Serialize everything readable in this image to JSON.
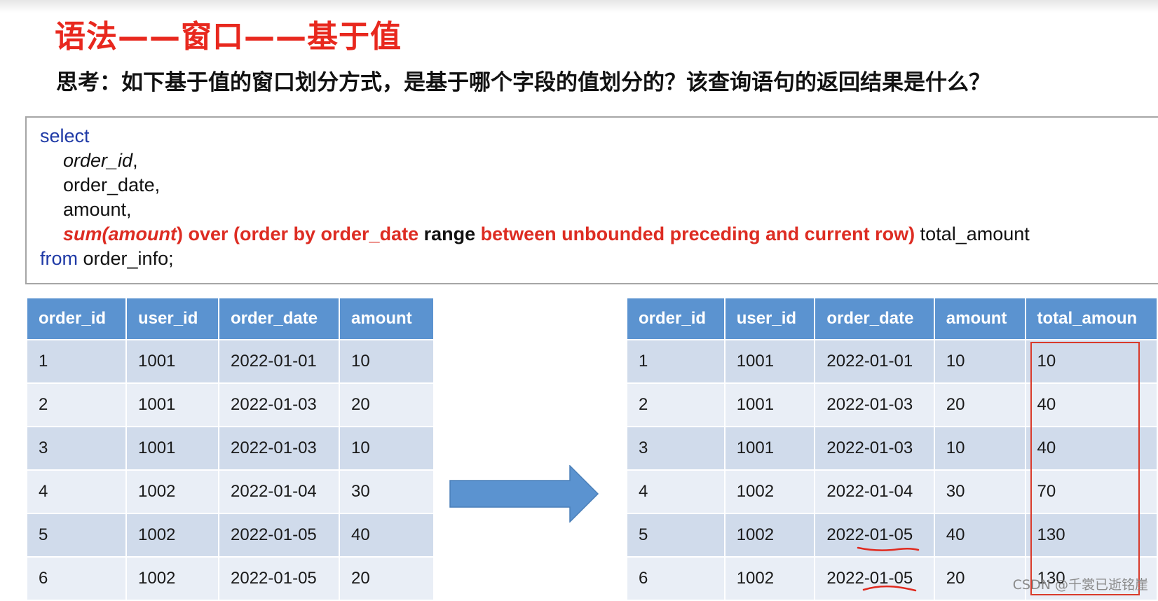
{
  "slide": {
    "title": "语法——窗口——基于值",
    "question": "思考：如下基于值的窗口划分方式，是基于哪个字段的值划分的？该查询语句的返回结果是什么？"
  },
  "sql": {
    "select_kw": "select",
    "line_order_id": "order_id",
    "comma1": ",",
    "line_order_date": "order_date,",
    "line_amount": "amount,",
    "fn_sum": "sum(amount",
    "fn_over": ") over (order by order_date",
    "kw_range": " range ",
    "frame": "between unbounded preceding and current row)",
    "alias": " total_amount",
    "from_kw": "from",
    "from_table": " order_info;"
  },
  "source_table": {
    "columns": [
      "order_id",
      "user_id",
      "order_date",
      "amount"
    ],
    "rows": [
      [
        "1",
        "1001",
        "2022-01-01",
        "10"
      ],
      [
        "2",
        "1001",
        "2022-01-03",
        "20"
      ],
      [
        "3",
        "1001",
        "2022-01-03",
        "10"
      ],
      [
        "4",
        "1002",
        "2022-01-04",
        "30"
      ],
      [
        "5",
        "1002",
        "2022-01-05",
        "40"
      ],
      [
        "6",
        "1002",
        "2022-01-05",
        "20"
      ]
    ]
  },
  "result_table": {
    "columns": [
      "order_id",
      "user_id",
      "order_date",
      "amount",
      "total_amoun"
    ],
    "rows": [
      [
        "1",
        "1001",
        "2022-01-01",
        "10",
        "10"
      ],
      [
        "2",
        "1001",
        "2022-01-03",
        "20",
        "40"
      ],
      [
        "3",
        "1001",
        "2022-01-03",
        "10",
        "40"
      ],
      [
        "4",
        "1002",
        "2022-01-04",
        "30",
        "70"
      ],
      [
        "5",
        "1002",
        "2022-01-05",
        "40",
        "130"
      ],
      [
        "6",
        "1002",
        "2022-01-05",
        "20",
        "130"
      ]
    ]
  },
  "watermark": "CSDN @千裳已逝铭崖",
  "colors": {
    "title_red": "#e8281e",
    "keyword_blue": "#1f3aa6",
    "header_blue": "#5b93d0",
    "row_dark": "#d0dbeb",
    "row_light": "#e9eef6",
    "highlight_red": "#d93a2b"
  }
}
